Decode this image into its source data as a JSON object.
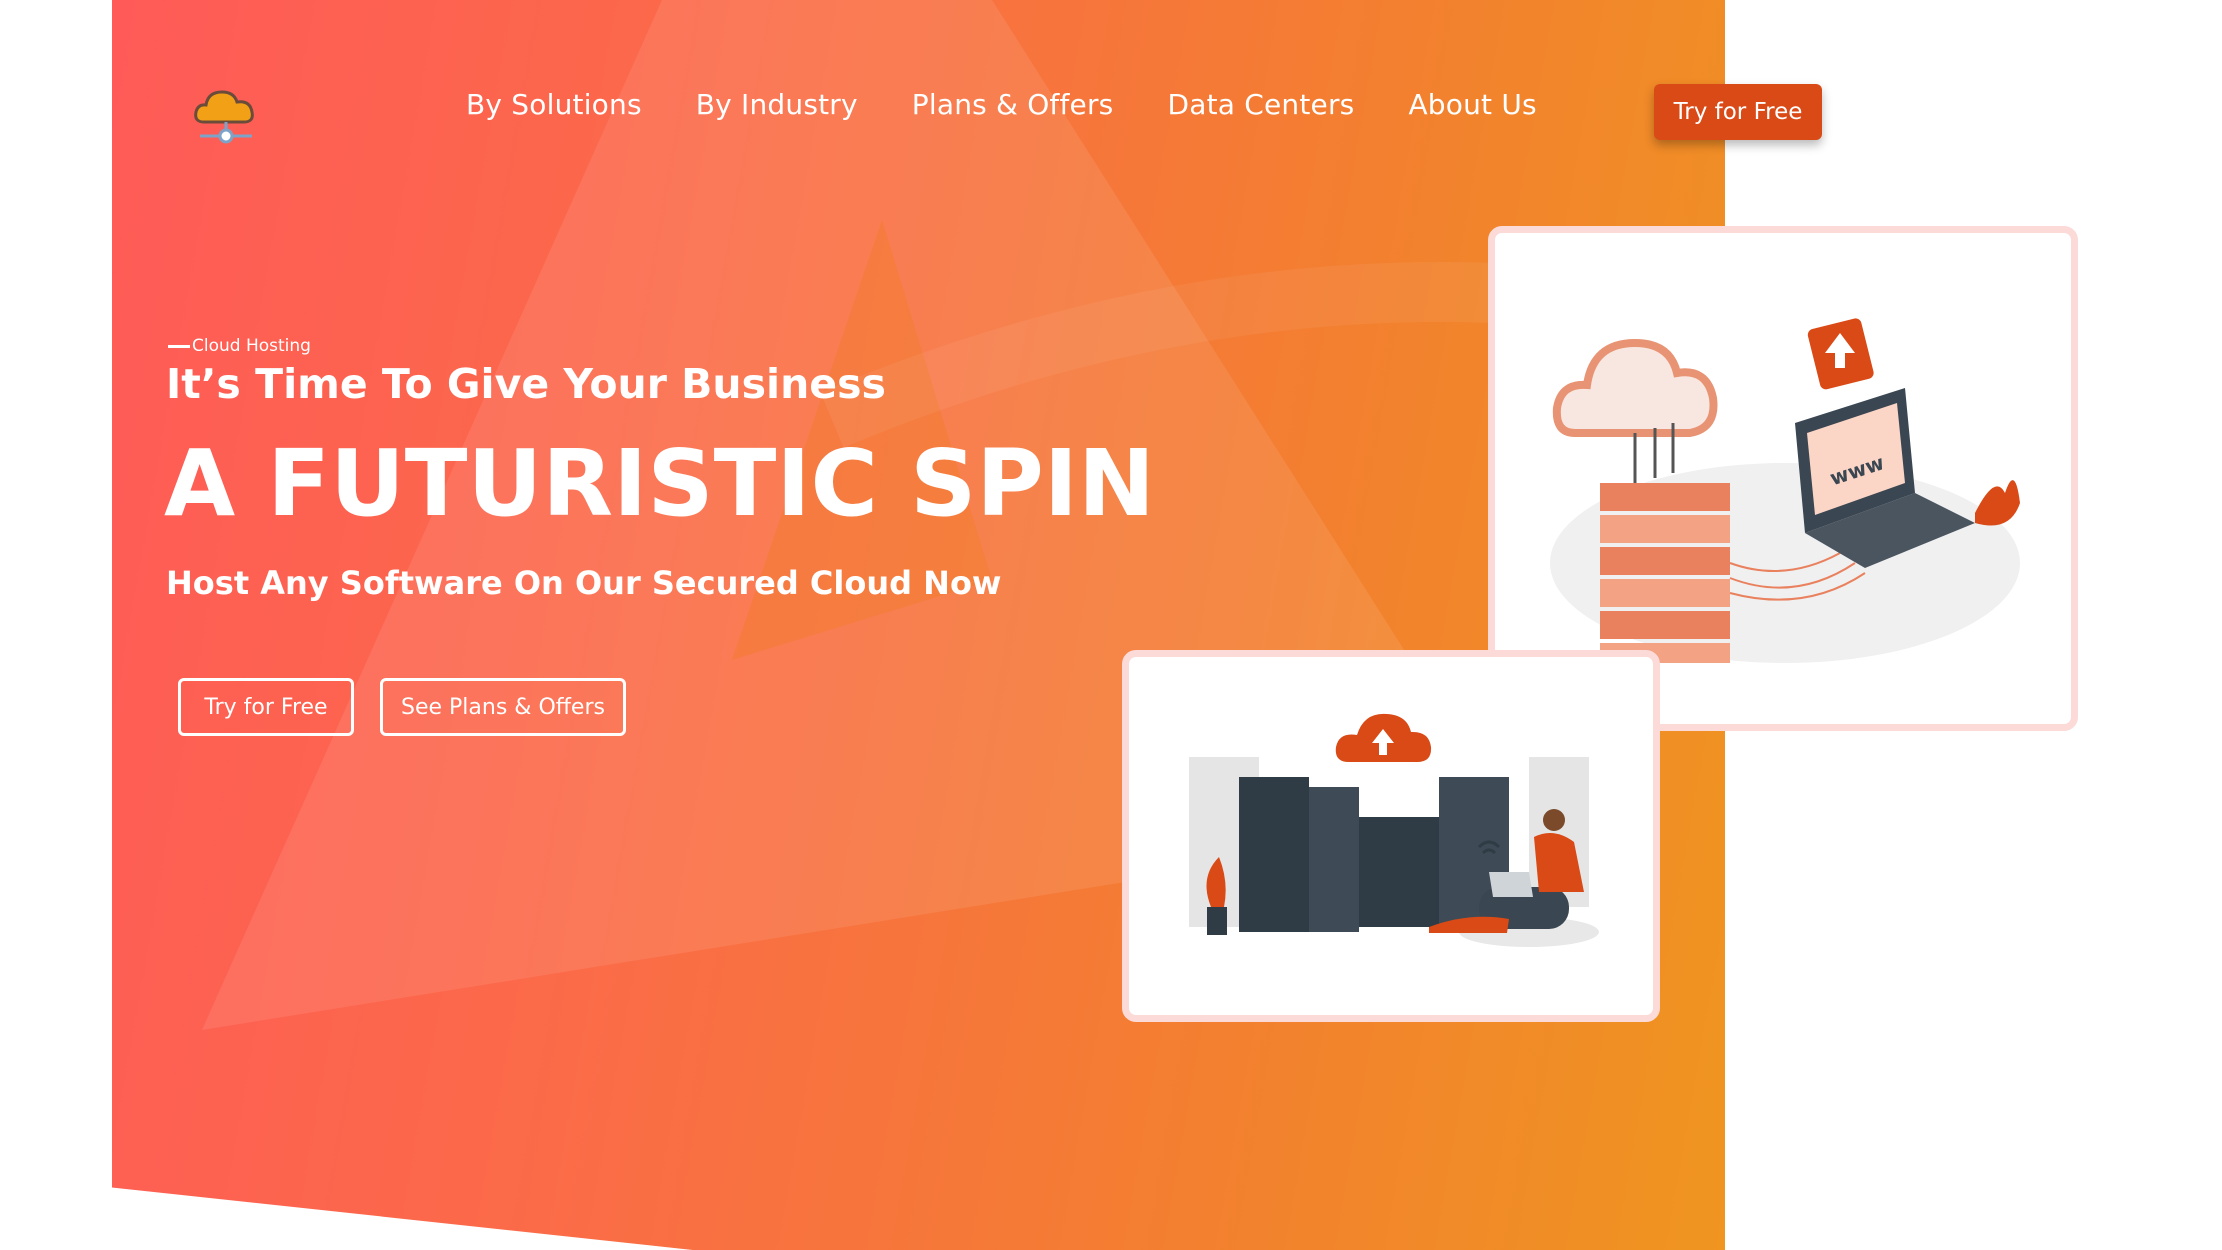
{
  "brand": {
    "logo_icon": "cloud-network-icon",
    "accent": "#d94a16",
    "gradient_start": "#ff5a58",
    "gradient_end": "#ef9520"
  },
  "nav": {
    "items": [
      "By Solutions",
      "By Industry",
      "Plans & Offers",
      "Data Centers",
      "About Us"
    ]
  },
  "header": {
    "cta_label": "Try for Free"
  },
  "hero": {
    "eyebrow": "Cloud Hosting",
    "line1": "It’s Time To Give Your Business",
    "headline": "A FUTURISTIC SPIN",
    "subline": "Host Any Software On Our Secured Cloud Now",
    "primary_label": "Try for Free",
    "secondary_label": "See Plans & Offers"
  },
  "illustrations": {
    "top_label": "www",
    "top_icons": [
      "cloud-icon",
      "server-stack-icon",
      "laptop-icon",
      "upload-icon"
    ],
    "bottom_icons": [
      "cloud-upload-icon",
      "server-rack-icon",
      "wifi-icon",
      "person-with-laptop-icon"
    ]
  }
}
